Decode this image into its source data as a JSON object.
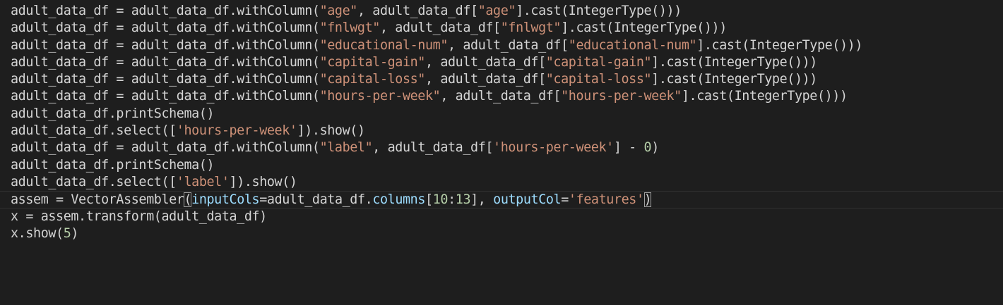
{
  "editor": {
    "colors": {
      "background": "#1e1e1e",
      "text": "#d4d4d4",
      "string": "#ce9178",
      "number": "#b5cea8",
      "parameter": "#9cdcfe"
    },
    "lines": [
      [
        {
          "t": "adult_data_df = adult_data_df.withColumn(",
          "k": "plain"
        },
        {
          "t": "\"age\"",
          "k": "str"
        },
        {
          "t": ", adult_data_df[",
          "k": "plain"
        },
        {
          "t": "\"age\"",
          "k": "str"
        },
        {
          "t": "].cast(IntegerType()))",
          "k": "plain"
        }
      ],
      [
        {
          "t": "adult_data_df = adult_data_df.withColumn(",
          "k": "plain"
        },
        {
          "t": "\"fnlwgt\"",
          "k": "str"
        },
        {
          "t": ", adult_data_df[",
          "k": "plain"
        },
        {
          "t": "\"fnlwgt\"",
          "k": "str"
        },
        {
          "t": "].cast(IntegerType()))",
          "k": "plain"
        }
      ],
      [
        {
          "t": "adult_data_df = adult_data_df.withColumn(",
          "k": "plain"
        },
        {
          "t": "\"educational-num\"",
          "k": "str"
        },
        {
          "t": ", adult_data_df[",
          "k": "plain"
        },
        {
          "t": "\"educational-num\"",
          "k": "str"
        },
        {
          "t": "].cast(IntegerType()))",
          "k": "plain"
        }
      ],
      [
        {
          "t": "adult_data_df = adult_data_df.withColumn(",
          "k": "plain"
        },
        {
          "t": "\"capital-gain\"",
          "k": "str"
        },
        {
          "t": ", adult_data_df[",
          "k": "plain"
        },
        {
          "t": "\"capital-gain\"",
          "k": "str"
        },
        {
          "t": "].cast(IntegerType()))",
          "k": "plain"
        }
      ],
      [
        {
          "t": "adult_data_df = adult_data_df.withColumn(",
          "k": "plain"
        },
        {
          "t": "\"capital-loss\"",
          "k": "str"
        },
        {
          "t": ", adult_data_df[",
          "k": "plain"
        },
        {
          "t": "\"capital-loss\"",
          "k": "str"
        },
        {
          "t": "].cast(IntegerType()))",
          "k": "plain"
        }
      ],
      [
        {
          "t": "adult_data_df = adult_data_df.withColumn(",
          "k": "plain"
        },
        {
          "t": "\"hours-per-week\"",
          "k": "str"
        },
        {
          "t": ", adult_data_df[",
          "k": "plain"
        },
        {
          "t": "\"hours-per-week\"",
          "k": "str"
        },
        {
          "t": "].cast(IntegerType()))",
          "k": "plain"
        }
      ],
      [
        {
          "t": "adult_data_df.printSchema()",
          "k": "plain"
        }
      ],
      [
        {
          "t": "adult_data_df.select([",
          "k": "plain"
        },
        {
          "t": "'hours-per-week'",
          "k": "str"
        },
        {
          "t": "]).show()",
          "k": "plain"
        }
      ],
      [
        {
          "t": "adult_data_df = adult_data_df.withColumn(",
          "k": "plain"
        },
        {
          "t": "\"label\"",
          "k": "str"
        },
        {
          "t": ", adult_data_df[",
          "k": "plain"
        },
        {
          "t": "'hours-per-week'",
          "k": "str"
        },
        {
          "t": "] - ",
          "k": "plain"
        },
        {
          "t": "0",
          "k": "num"
        },
        {
          "t": ")",
          "k": "plain"
        }
      ],
      [
        {
          "t": "adult_data_df.printSchema()",
          "k": "plain"
        }
      ],
      [
        {
          "t": "adult_data_df.select([",
          "k": "plain"
        },
        {
          "t": "'label'",
          "k": "str"
        },
        {
          "t": "]).show()",
          "k": "plain"
        }
      ],
      [
        {
          "t": "assem = VectorAssembler",
          "k": "plain"
        },
        {
          "t": "(",
          "k": "bracket"
        },
        {
          "t": "inputCols",
          "k": "param"
        },
        {
          "t": "=adult_data_df.",
          "k": "plain"
        },
        {
          "t": "columns",
          "k": "param"
        },
        {
          "t": "[",
          "k": "plain"
        },
        {
          "t": "10",
          "k": "num"
        },
        {
          "t": ":",
          "k": "plain"
        },
        {
          "t": "13",
          "k": "num"
        },
        {
          "t": "], ",
          "k": "plain"
        },
        {
          "t": "outputCol",
          "k": "param"
        },
        {
          "t": "=",
          "k": "plain"
        },
        {
          "t": "'features'",
          "k": "str"
        },
        {
          "t": ")",
          "k": "bracket"
        }
      ],
      [
        {
          "t": "x = assem.transform(adult_data_df)",
          "k": "plain"
        }
      ],
      [
        {
          "t": "x.show(",
          "k": "plain"
        },
        {
          "t": "5",
          "k": "num"
        },
        {
          "t": ")",
          "k": "plain"
        }
      ]
    ],
    "current_line": 11
  }
}
